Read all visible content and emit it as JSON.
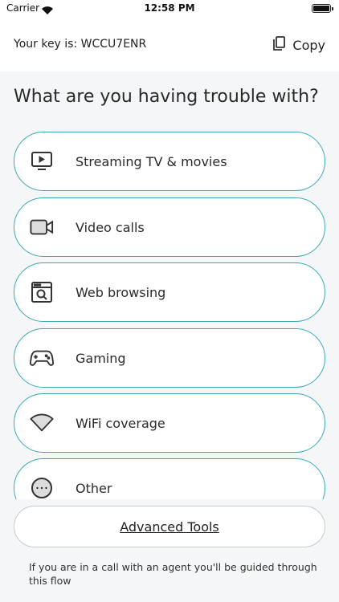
{
  "status_bar": {
    "carrier": "Carrier",
    "time": "12:58 PM"
  },
  "key_bar": {
    "key_text": "Your key is: WCCU7ENR",
    "copy_label": "Copy"
  },
  "main": {
    "heading": "What are you having trouble with?",
    "options": [
      {
        "label": "Streaming TV & movies",
        "icon": "tv-play-icon"
      },
      {
        "label": "Video calls",
        "icon": "video-camera-icon"
      },
      {
        "label": "Web browsing",
        "icon": "browser-search-icon"
      },
      {
        "label": "Gaming",
        "icon": "gamepad-icon"
      },
      {
        "label": "WiFi coverage",
        "icon": "wifi-icon"
      },
      {
        "label": "Other",
        "icon": "more-dots-icon"
      }
    ]
  },
  "advanced_tools_label": "Advanced Tools",
  "footer_note": "If you are in a call with an agent you'll be guided through this flow",
  "colors": {
    "accent_border": "#39a9b4",
    "background": "#f5f6f8"
  }
}
